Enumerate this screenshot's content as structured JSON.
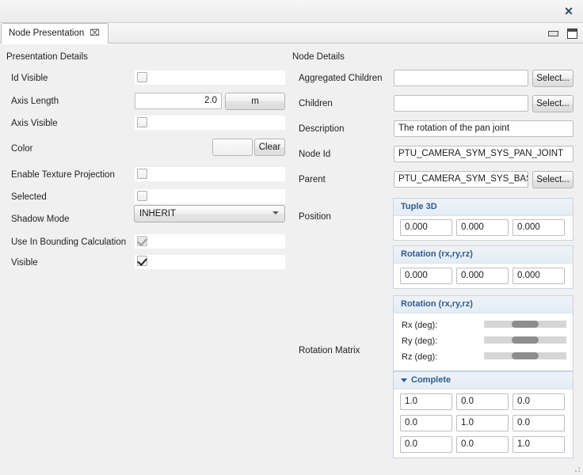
{
  "window": {
    "close_label": "✕",
    "minimize_icon": "minimize",
    "maximize_icon": "maximize"
  },
  "tab": {
    "label": "Node Presentation",
    "close_glyph": "⌧"
  },
  "left_panel": {
    "title": "Presentation Details",
    "rows": [
      {
        "label": "Id Visible",
        "type": "checkbox",
        "checked": false,
        "disabled": false
      },
      {
        "label": "Axis Length",
        "type": "text-unit",
        "value": "2.0",
        "unit": "m"
      },
      {
        "label": "Axis Visible",
        "type": "checkbox",
        "checked": false,
        "disabled": false
      },
      {
        "label": "Color",
        "type": "color",
        "clear_label": "Clear"
      },
      {
        "label": "Enable Texture Projection",
        "type": "checkbox",
        "checked": false,
        "disabled": false
      },
      {
        "label": "Selected",
        "type": "checkbox",
        "checked": false,
        "disabled": false
      },
      {
        "label": "Shadow Mode",
        "type": "combo",
        "value": "INHERIT"
      },
      {
        "label": "Use In Bounding Calculation",
        "type": "checkbox",
        "checked": true,
        "disabled": true
      },
      {
        "label": "Visible",
        "type": "checkbox",
        "checked": true,
        "disabled": false
      }
    ]
  },
  "right_panel": {
    "title": "Node Details",
    "rows": [
      {
        "label": "Aggregated Children",
        "value": "",
        "button": "Select..."
      },
      {
        "label": "Children",
        "value": "",
        "button": "Select..."
      },
      {
        "label": "Description",
        "value": "The rotation of the pan joint",
        "button": null
      },
      {
        "label": "Node Id",
        "value": "PTU_CAMERA_SYM_SYS_PAN_JOINT",
        "button": null
      },
      {
        "label": "Parent",
        "value": "PTU_CAMERA_SYM_SYS_BASE_TO",
        "button": "Select..."
      }
    ],
    "position": {
      "label": "Position",
      "group_title": "Tuple 3D",
      "values": [
        "0.000",
        "0.000",
        "0.000"
      ]
    },
    "rotation_matrix": {
      "label": "Rotation Matrix",
      "euler_group_title": "Rotation (rx,ry,rz)",
      "euler_values": [
        "0.000",
        "0.000",
        "0.000"
      ],
      "slider_group_title": "Rotation (rx,ry,rz)",
      "sliders": [
        {
          "label": "Rx (deg):",
          "value": 50
        },
        {
          "label": "Ry (deg):",
          "value": 50
        },
        {
          "label": "Rz (deg):",
          "value": 50
        }
      ],
      "complete_title": "Complete",
      "matrix": [
        [
          "1.0",
          "0.0",
          "0.0"
        ],
        [
          "0.0",
          "1.0",
          "0.0"
        ],
        [
          "0.0",
          "0.0",
          "1.0"
        ]
      ]
    }
  },
  "colors": {
    "accent": "#2f5c8f",
    "window_bg": "#f0f0f0",
    "field_bg": "#ffffff",
    "border": "#bdbdbd"
  }
}
